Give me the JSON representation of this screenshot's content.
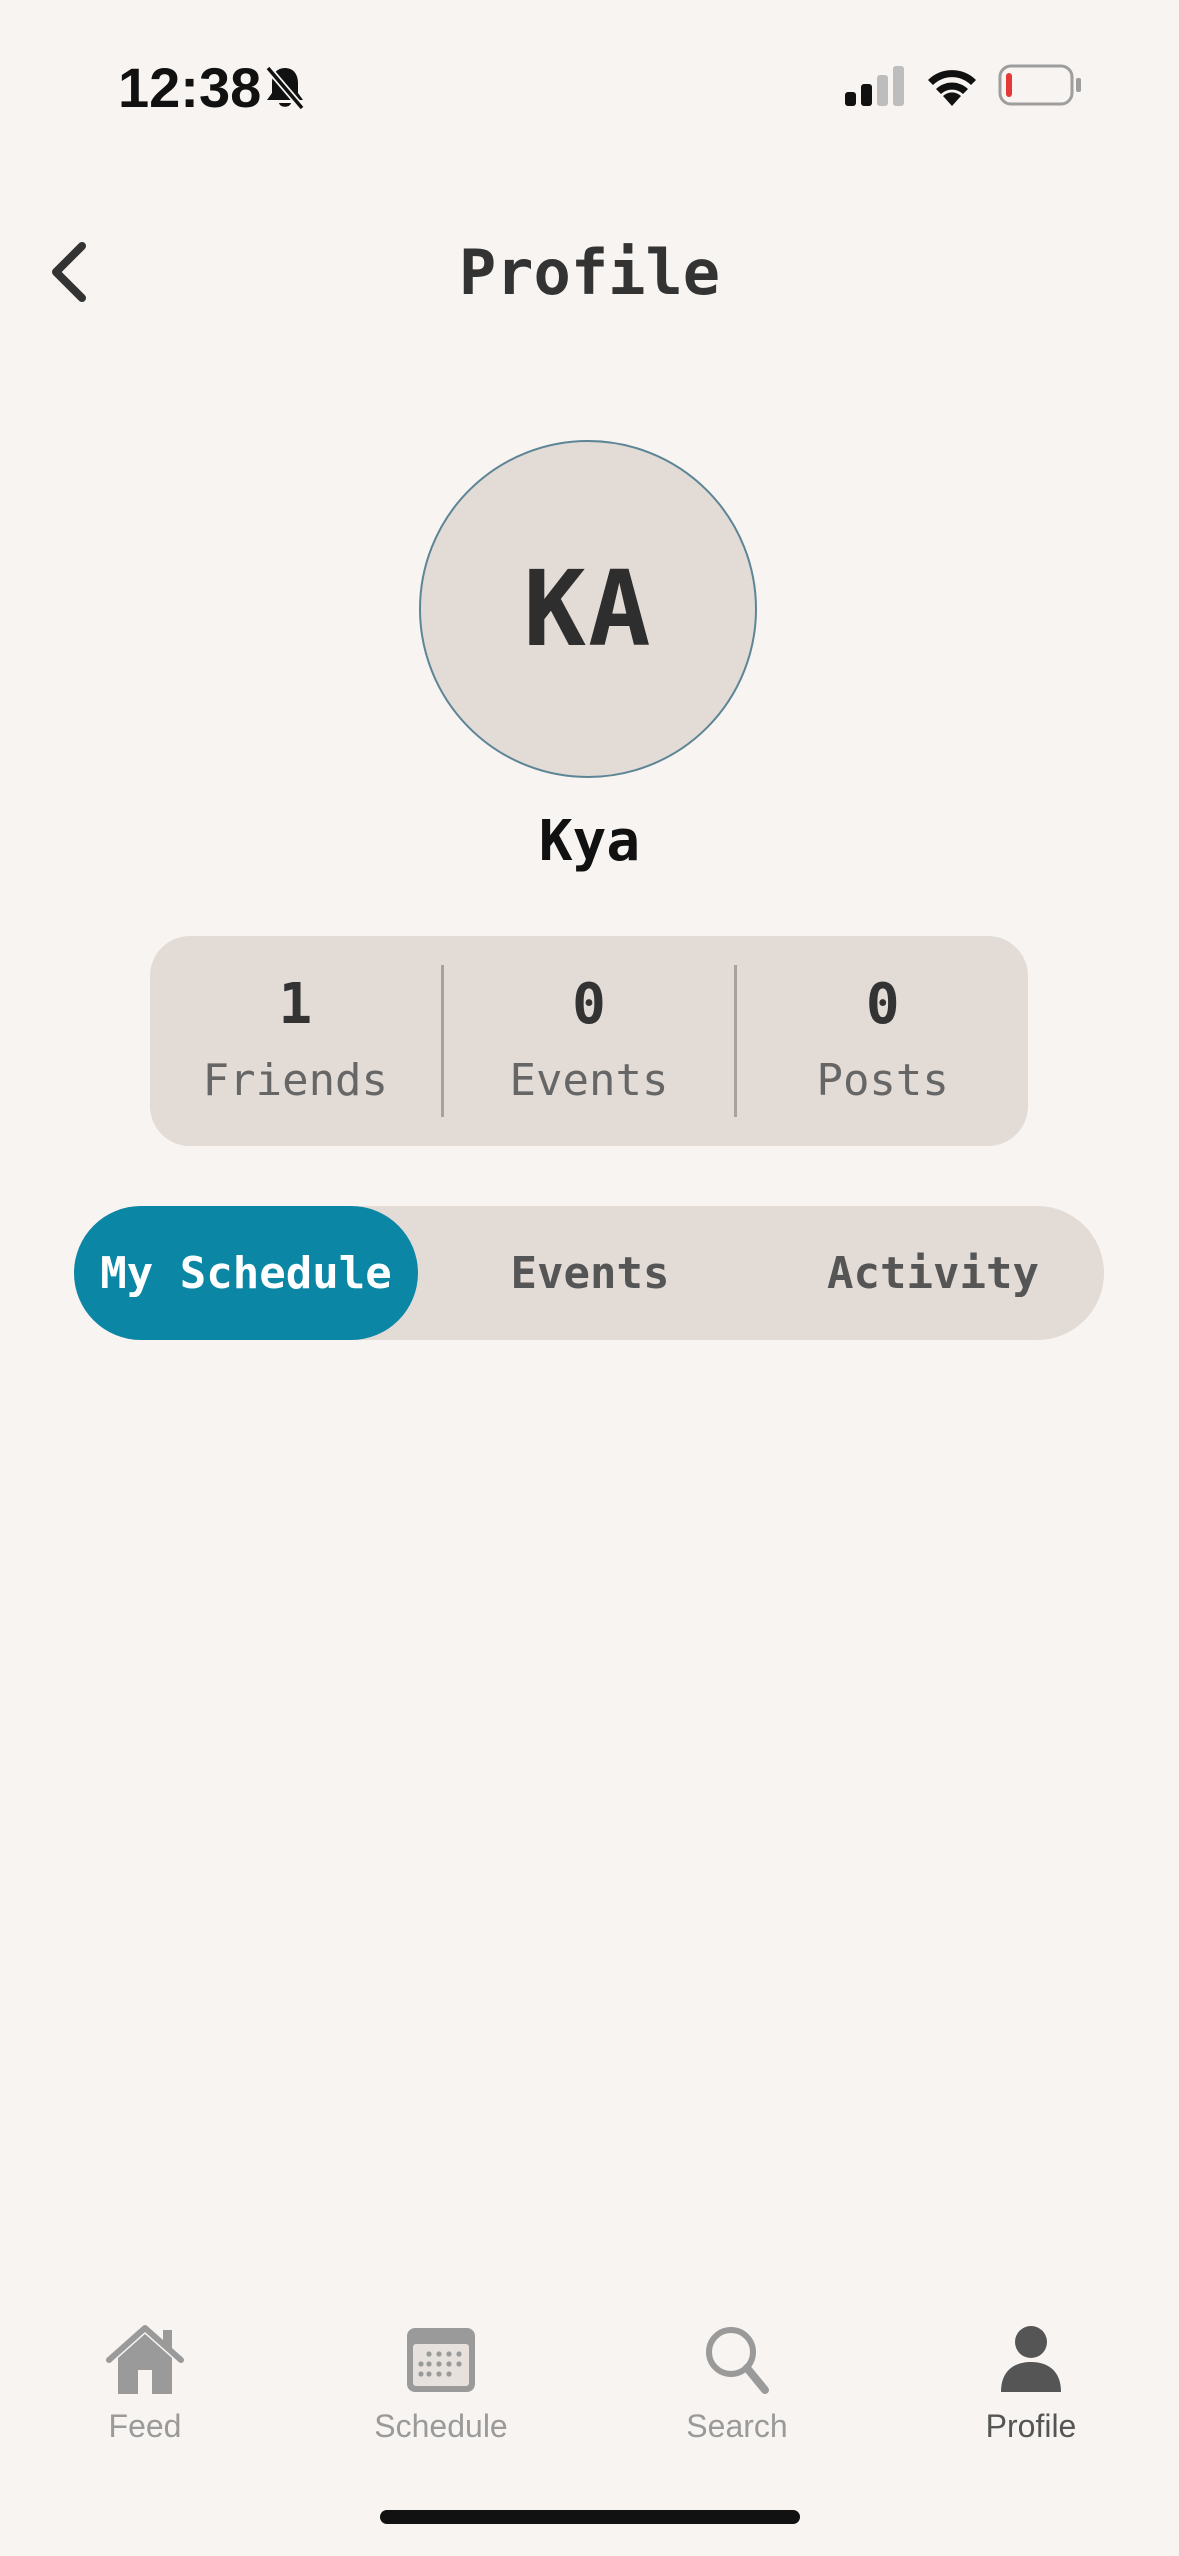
{
  "status_bar": {
    "time": "12:38",
    "icons": [
      "bell-slash-icon",
      "cellular-signal-icon",
      "wifi-icon",
      "battery-low-icon"
    ],
    "battery_color": "#e53935"
  },
  "header": {
    "back_icon": "chevron-left-icon",
    "title": "Profile"
  },
  "profile": {
    "initials": "KA",
    "name": "Kya",
    "avatar_bg": "#e2dbd6",
    "avatar_border": "#5d8596"
  },
  "stats": [
    {
      "value": "1",
      "label": "Friends"
    },
    {
      "value": "0",
      "label": "Events"
    },
    {
      "value": "0",
      "label": "Posts"
    }
  ],
  "tabs": {
    "active_color": "#0b87a5",
    "items": [
      {
        "label": "My Schedule",
        "active": true
      },
      {
        "label": "Events",
        "active": false
      },
      {
        "label": "Activity",
        "active": false
      }
    ]
  },
  "bottom_nav": {
    "items": [
      {
        "label": "Feed",
        "icon": "home-icon",
        "active": false
      },
      {
        "label": "Schedule",
        "icon": "calendar-icon",
        "active": false
      },
      {
        "label": "Search",
        "icon": "search-icon",
        "active": false
      },
      {
        "label": "Profile",
        "icon": "person-icon",
        "active": true
      }
    ]
  }
}
